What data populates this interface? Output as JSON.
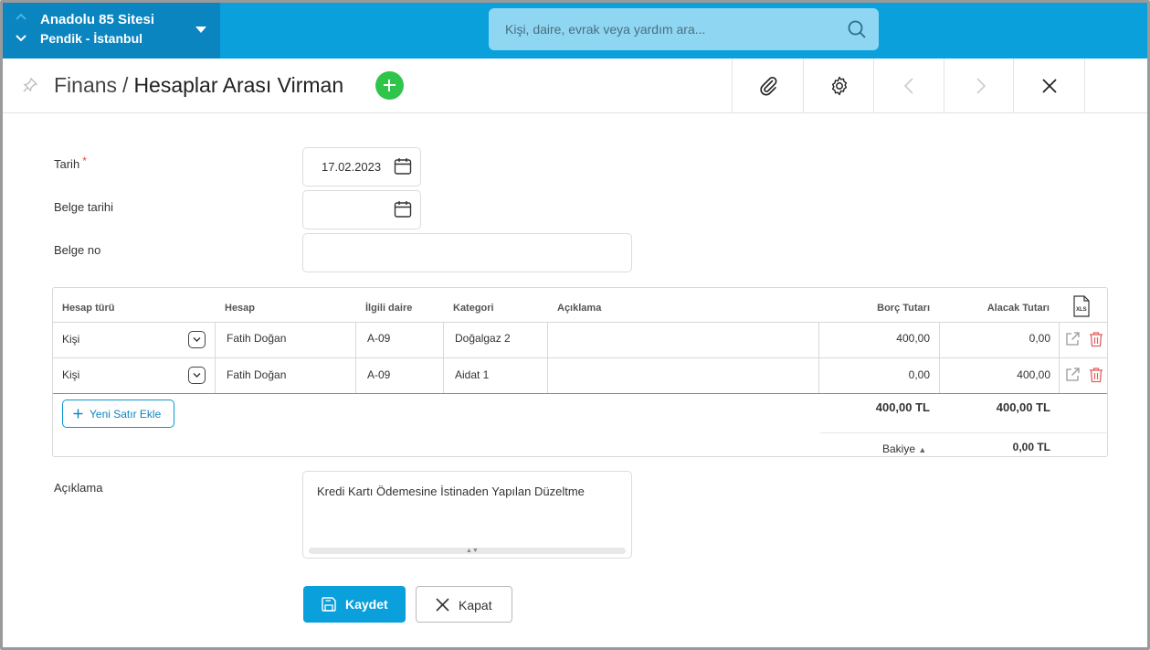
{
  "site": {
    "name": "Anadolu 85 Sitesi",
    "location": "Pendik - İstanbul"
  },
  "search": {
    "placeholder": "Kişi, daire, evrak veya yardım ara..."
  },
  "breadcrumb": {
    "parent": "Finans",
    "separator": "/",
    "current": "Hesaplar Arası Virman"
  },
  "form": {
    "date_label": "Tarih",
    "date_required_mark": "*",
    "date_value": "17.02.2023",
    "doc_date_label": "Belge tarihi",
    "doc_date_value": "",
    "doc_no_label": "Belge no",
    "doc_no_value": "",
    "description_label": "Açıklama",
    "description_value": "Kredi Kartı Ödemesine İstinaden Yapılan Düzeltme"
  },
  "table": {
    "columns": [
      "Hesap türü",
      "Hesap",
      "İlgili daire",
      "Kategori",
      "Açıklama",
      "Borç Tutarı",
      "Alacak Tutarı"
    ],
    "export_icon": "xls-icon",
    "rows": [
      {
        "type": "Kişi",
        "account": "Fatih Doğan",
        "unit": "A-09",
        "category": "Doğalgaz 2",
        "description": "",
        "debit": "400,00",
        "credit": "0,00"
      },
      {
        "type": "Kişi",
        "account": "Fatih Doğan",
        "unit": "A-09",
        "category": "Aidat 1",
        "description": "",
        "debit": "0,00",
        "credit": "400,00"
      }
    ],
    "add_row_label": "Yeni Satır Ekle",
    "total_debit": "400,00 TL",
    "total_credit": "400,00 TL",
    "balance_label": "Bakiye",
    "balance_value": "0,00 TL"
  },
  "buttons": {
    "save": "Kaydet",
    "close": "Kapat"
  },
  "colors": {
    "topbar": "#0aa0dc",
    "site_selector": "#0a85c0",
    "add_green": "#2fc54a",
    "delete_red": "#e06060"
  }
}
